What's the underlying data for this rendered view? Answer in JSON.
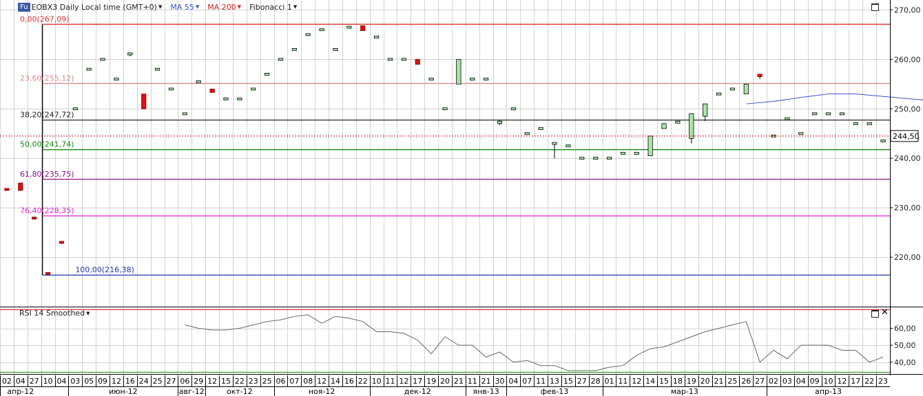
{
  "toolbar": {
    "symbol_badge": "Fu",
    "title": "EOBX3 Daily Local time (GMT+0)",
    "ma55": "MA 55",
    "ma200": "MA 200",
    "fibonacci": "Fibonacci 1"
  },
  "rsi_panel": {
    "label": "RSI 14 Smoothed"
  },
  "colors": {
    "ma55": "#3355cc",
    "ma200": "#cc2222",
    "up_candle": "#a8e6a8",
    "down_candle": "#dd1111",
    "rsi_line": "#666666",
    "price_line": "#cc0000"
  },
  "chart_data": [
    {
      "type": "candlestick",
      "ylim": [
        210,
        272
      ],
      "y_ticks": [
        "270,00",
        "260,00",
        "250,00",
        "240,00",
        "230,00",
        "220,00"
      ],
      "y_tick_values": [
        270,
        260,
        250,
        240,
        230,
        220
      ],
      "current_price": 244.5,
      "current_price_label": "244,50",
      "x_day_labels": [
        "02",
        "04",
        "27",
        "10",
        "04",
        "03",
        "05",
        "09",
        "12",
        "16",
        "24",
        "25",
        "27",
        "06",
        "29",
        "12",
        "15",
        "22",
        "23",
        "25",
        "06",
        "07",
        "08",
        "12",
        "14",
        "16",
        "22",
        "10",
        "11",
        "12",
        "17",
        "19",
        "20",
        "21",
        "11",
        "21",
        "30",
        "04",
        "07",
        "11",
        "13",
        "15",
        "27",
        "28",
        "01",
        "11",
        "12",
        "14",
        "15",
        "18",
        "19",
        "20",
        "21",
        "25",
        "26",
        "27",
        "02",
        "03",
        "04",
        "09",
        "10",
        "12",
        "17",
        "22",
        "23"
      ],
      "x_month_labels": [
        {
          "label": "апр-12",
          "start": 0,
          "end": 3
        },
        {
          "label": "июн-12",
          "start": 5,
          "end": 13
        },
        {
          "label": "авг-12",
          "start": 13,
          "end": 15
        },
        {
          "label": "окт-12",
          "start": 15,
          "end": 20
        },
        {
          "label": "ноя-12",
          "start": 20,
          "end": 27
        },
        {
          "label": "дек-12",
          "start": 27,
          "end": 34
        },
        {
          "label": "янв-13",
          "start": 34,
          "end": 37
        },
        {
          "label": "фев-13",
          "start": 37,
          "end": 44
        },
        {
          "label": "мар-13",
          "start": 44,
          "end": 56
        },
        {
          "label": "апр-13",
          "start": 56,
          "end": 65
        }
      ],
      "candles": [
        {
          "o": 233.8,
          "h": 233.8,
          "l": 233.4,
          "c": 233.6
        },
        {
          "o": 235.0,
          "h": 235.0,
          "l": 233.5,
          "c": 233.5
        },
        {
          "o": 228.0,
          "h": 228.0,
          "l": 227.6,
          "c": 227.8
        },
        {
          "o": 216.8,
          "h": 216.8,
          "l": 216.4,
          "c": 216.6
        },
        {
          "o": 223.1,
          "h": 223.1,
          "l": 222.7,
          "c": 222.9
        },
        {
          "o": 250.0,
          "h": 250.2,
          "l": 249.8,
          "c": 250.0
        },
        {
          "o": 258.0,
          "h": 258.2,
          "l": 257.8,
          "c": 258.0
        },
        {
          "o": 260.0,
          "h": 260.2,
          "l": 259.8,
          "c": 260.0
        },
        {
          "o": 256.0,
          "h": 256.2,
          "l": 255.8,
          "c": 256.0
        },
        {
          "o": 261.0,
          "h": 261.4,
          "l": 260.6,
          "c": 261.2
        },
        {
          "o": 253.0,
          "h": 253.0,
          "l": 250.0,
          "c": 250.0
        },
        {
          "o": 258.0,
          "h": 258.2,
          "l": 257.8,
          "c": 258.0
        },
        {
          "o": 254.0,
          "h": 254.2,
          "l": 253.8,
          "c": 254.0
        },
        {
          "o": 249.0,
          "h": 249.2,
          "l": 248.8,
          "c": 249.0
        },
        {
          "o": 255.5,
          "h": 255.7,
          "l": 255.3,
          "c": 255.5
        },
        {
          "o": 254.0,
          "h": 254.0,
          "l": 253.3,
          "c": 253.3
        },
        {
          "o": 252.0,
          "h": 252.2,
          "l": 251.8,
          "c": 252.0
        },
        {
          "o": 252.0,
          "h": 252.2,
          "l": 251.8,
          "c": 252.0
        },
        {
          "o": 254.0,
          "h": 254.2,
          "l": 253.8,
          "c": 254.0
        },
        {
          "o": 257.0,
          "h": 257.2,
          "l": 256.8,
          "c": 257.0
        },
        {
          "o": 260.0,
          "h": 260.2,
          "l": 259.8,
          "c": 260.0
        },
        {
          "o": 262.0,
          "h": 262.2,
          "l": 261.8,
          "c": 262.0
        },
        {
          "o": 265.0,
          "h": 265.2,
          "l": 264.8,
          "c": 265.0
        },
        {
          "o": 266.0,
          "h": 266.2,
          "l": 265.8,
          "c": 266.0
        },
        {
          "o": 262.0,
          "h": 262.2,
          "l": 261.8,
          "c": 262.0
        },
        {
          "o": 266.5,
          "h": 266.7,
          "l": 266.3,
          "c": 266.5
        },
        {
          "o": 266.8,
          "h": 266.8,
          "l": 265.8,
          "c": 265.8
        },
        {
          "o": 264.5,
          "h": 264.7,
          "l": 264.3,
          "c": 264.5
        },
        {
          "o": 260.0,
          "h": 260.2,
          "l": 259.8,
          "c": 260.0
        },
        {
          "o": 260.0,
          "h": 260.2,
          "l": 259.8,
          "c": 260.0
        },
        {
          "o": 260.0,
          "h": 260.0,
          "l": 259.0,
          "c": 259.0
        },
        {
          "o": 256.0,
          "h": 256.2,
          "l": 255.8,
          "c": 256.0
        },
        {
          "o": 250.0,
          "h": 250.2,
          "l": 249.8,
          "c": 250.0
        },
        {
          "o": 255.0,
          "h": 260.0,
          "l": 255.0,
          "c": 260.0
        },
        {
          "o": 256.0,
          "h": 256.2,
          "l": 255.8,
          "c": 256.0
        },
        {
          "o": 256.0,
          "h": 256.2,
          "l": 255.8,
          "c": 256.0
        },
        {
          "o": 247.0,
          "h": 247.7,
          "l": 246.7,
          "c": 247.5
        },
        {
          "o": 250.0,
          "h": 250.2,
          "l": 249.8,
          "c": 250.0
        },
        {
          "o": 245.0,
          "h": 245.2,
          "l": 244.8,
          "c": 245.0
        },
        {
          "o": 246.0,
          "h": 246.2,
          "l": 245.8,
          "c": 246.0
        },
        {
          "o": 243.0,
          "h": 243.2,
          "l": 240.0,
          "c": 243.0
        },
        {
          "o": 242.5,
          "h": 242.7,
          "l": 242.3,
          "c": 242.5
        },
        {
          "o": 240.0,
          "h": 240.2,
          "l": 239.8,
          "c": 240.0
        },
        {
          "o": 240.0,
          "h": 240.2,
          "l": 239.8,
          "c": 240.0
        },
        {
          "o": 240.0,
          "h": 240.2,
          "l": 239.8,
          "c": 240.0
        },
        {
          "o": 241.0,
          "h": 241.2,
          "l": 240.8,
          "c": 241.0
        },
        {
          "o": 241.0,
          "h": 241.2,
          "l": 240.8,
          "c": 241.0
        },
        {
          "o": 240.5,
          "h": 244.5,
          "l": 240.5,
          "c": 244.5
        },
        {
          "o": 246.0,
          "h": 247.0,
          "l": 246.0,
          "c": 247.0
        },
        {
          "o": 247.3,
          "h": 247.5,
          "l": 247.1,
          "c": 247.3
        },
        {
          "o": 244.0,
          "h": 249.0,
          "l": 243.0,
          "c": 249.0
        },
        {
          "o": 248.5,
          "h": 251.0,
          "l": 247.5,
          "c": 251.0
        },
        {
          "o": 253.0,
          "h": 253.2,
          "l": 252.8,
          "c": 253.0
        },
        {
          "o": 254.0,
          "h": 254.2,
          "l": 253.8,
          "c": 254.0
        },
        {
          "o": 253.0,
          "h": 255.0,
          "l": 253.0,
          "c": 255.0
        },
        {
          "o": 257.0,
          "h": 257.0,
          "l": 256.0,
          "c": 256.5
        },
        {
          "o": 244.5,
          "h": 244.7,
          "l": 244.3,
          "c": 244.5
        },
        {
          "o": 248.0,
          "h": 248.2,
          "l": 247.8,
          "c": 248.0
        },
        {
          "o": 245.0,
          "h": 245.2,
          "l": 244.8,
          "c": 245.0
        },
        {
          "o": 249.0,
          "h": 249.2,
          "l": 248.8,
          "c": 249.0
        },
        {
          "o": 249.0,
          "h": 249.2,
          "l": 248.8,
          "c": 249.0
        },
        {
          "o": 249.0,
          "h": 249.2,
          "l": 248.8,
          "c": 249.0
        },
        {
          "o": 247.0,
          "h": 247.2,
          "l": 246.8,
          "c": 247.0
        },
        {
          "o": 247.0,
          "h": 247.2,
          "l": 246.8,
          "c": 247.0
        },
        {
          "o": 243.5,
          "h": 243.7,
          "l": 243.3,
          "c": 243.5
        },
        {
          "o": 244.5,
          "h": 244.7,
          "l": 244.3,
          "c": 244.5
        }
      ],
      "ma55": [
        {
          "i": 54,
          "v": 251.0
        },
        {
          "i": 56,
          "v": 251.5
        },
        {
          "i": 58,
          "v": 252.3
        },
        {
          "i": 60,
          "v": 253.0
        },
        {
          "i": 62,
          "v": 253.0
        },
        {
          "i": 64,
          "v": 252.5
        },
        {
          "i": 66,
          "v": 252.0
        },
        {
          "i": 67,
          "v": 251.8
        }
      ],
      "fibonacci": {
        "anchor_index": 3,
        "levels": [
          {
            "label": "0,00(267,09)",
            "value": 267.09,
            "color": "#dd3333"
          },
          {
            "label": "23,60(255,12)",
            "value": 255.12,
            "color": "#d98888"
          },
          {
            "label": "38,20(247,72)",
            "value": 247.72,
            "color": "#222222"
          },
          {
            "label": "50,00(241,74)",
            "value": 241.74,
            "color": "#118811"
          },
          {
            "label": "61,80(235,75)",
            "value": 235.75,
            "color": "#881188"
          },
          {
            "label": "76,40(228,35)",
            "value": 228.35,
            "color": "#dd22cc"
          },
          {
            "label": "100,00(216,38)",
            "value": 216.38,
            "color": "#2233aa"
          }
        ]
      }
    },
    {
      "type": "line",
      "title": "RSI 14 Smoothed",
      "ylim": [
        33,
        72
      ],
      "y_ticks": [
        "60,00",
        "50,00",
        "40,00"
      ],
      "y_tick_values": [
        60,
        50,
        40
      ],
      "series": [
        {
          "name": "RSI 14 Smoothed",
          "start_index": 13,
          "values": [
            62,
            60,
            59,
            59,
            60,
            62,
            64,
            65,
            67,
            68,
            63,
            67,
            66,
            64,
            58,
            58,
            57,
            53,
            45,
            55,
            50,
            50,
            43,
            46,
            40,
            41,
            38,
            38,
            35,
            35,
            35,
            37,
            38,
            44,
            48,
            49,
            52,
            55,
            58,
            60,
            62,
            64,
            40,
            47,
            42,
            50,
            50,
            50,
            47,
            47,
            40,
            43
          ]
        }
      ]
    }
  ]
}
